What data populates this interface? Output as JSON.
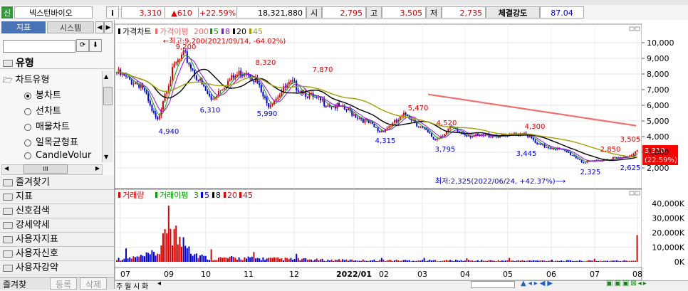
{
  "header": {
    "market_badge": "신",
    "stock_name": "넥스턴바이오",
    "info_button": "i",
    "price": "3,310",
    "change": "▲610",
    "change_pct": "+22.59%",
    "volume": "18,321,880",
    "open_label": "시",
    "open": "2,795",
    "high_label": "고",
    "high": "3,505",
    "low_label": "저",
    "low": "2,735",
    "strength_label": "체결강도",
    "strength": "87.04"
  },
  "left_panel": {
    "tabs": [
      "지표",
      "시스템"
    ],
    "section_title": "유형",
    "tree_root": "차트유형",
    "chart_types": [
      {
        "label": "봉차트",
        "selected": true
      },
      {
        "label": "선차트",
        "selected": false
      },
      {
        "label": "매물차트",
        "selected": false
      },
      {
        "label": "일목균형표",
        "selected": false
      },
      {
        "label": "CandleVolur",
        "selected": false
      }
    ],
    "scroll_mid": "III",
    "categories": [
      "즐겨찾기",
      "지표",
      "신호검색",
      "강세약세",
      "사용자지표",
      "사용자신호",
      "사용자강약"
    ],
    "bottom_tabs": [
      "즐겨찾",
      "등록",
      "삭제"
    ]
  },
  "price_chart": {
    "legend": {
      "title": "가격차트",
      "ma_title": "가격이평",
      "ma_periods": [
        "200",
        "5",
        "8",
        "20",
        "45"
      ]
    },
    "y_ticks": [
      "10,000",
      "9,000",
      "8,000",
      "7,000",
      "6,000",
      "5,000",
      "4,000",
      "3,000",
      "2,000"
    ],
    "current_price_tag": "3,310",
    "current_pct_tag": "(22.59%)",
    "annotations": {
      "high_note": "←최고:9,200(2021/09/14, -64.02%)",
      "low_note": "최저:2,325(2022/06/24, +42.37%)⟶",
      "point_labels": [
        "9,200",
        "8,320",
        "7,870",
        "6,310",
        "5,990",
        "4,940",
        "5,470",
        "4,520",
        "4,315",
        "3,795",
        "4,300",
        "3,445",
        "3,505",
        "2,850",
        "2,625",
        "2,325"
      ]
    }
  },
  "volume_chart": {
    "legend": {
      "title": "거래량",
      "ma_title": "거래이평",
      "ma_periods": [
        "3",
        "5",
        "8",
        "20",
        "45"
      ]
    },
    "y_ticks": [
      "40,000K",
      "30,000K",
      "20,000K",
      "10,000K",
      "0K"
    ]
  },
  "x_axis": {
    "labels": [
      "07",
      "09",
      "10",
      "11",
      "12",
      "2022/01",
      "02",
      "03",
      "04",
      "05",
      "06",
      "07",
      "08"
    ]
  },
  "bottom_bar": {
    "tabs": [
      "주",
      "월",
      "시",
      "화"
    ]
  },
  "colors": {
    "up": "#e00000",
    "down": "#0000e0",
    "ma5": "#00a000",
    "ma8": "#a000ff",
    "ma20": "#000000",
    "ma45": "#a0a000",
    "ma200": "#f07070",
    "price_tag_bg": "#ff0000"
  }
}
